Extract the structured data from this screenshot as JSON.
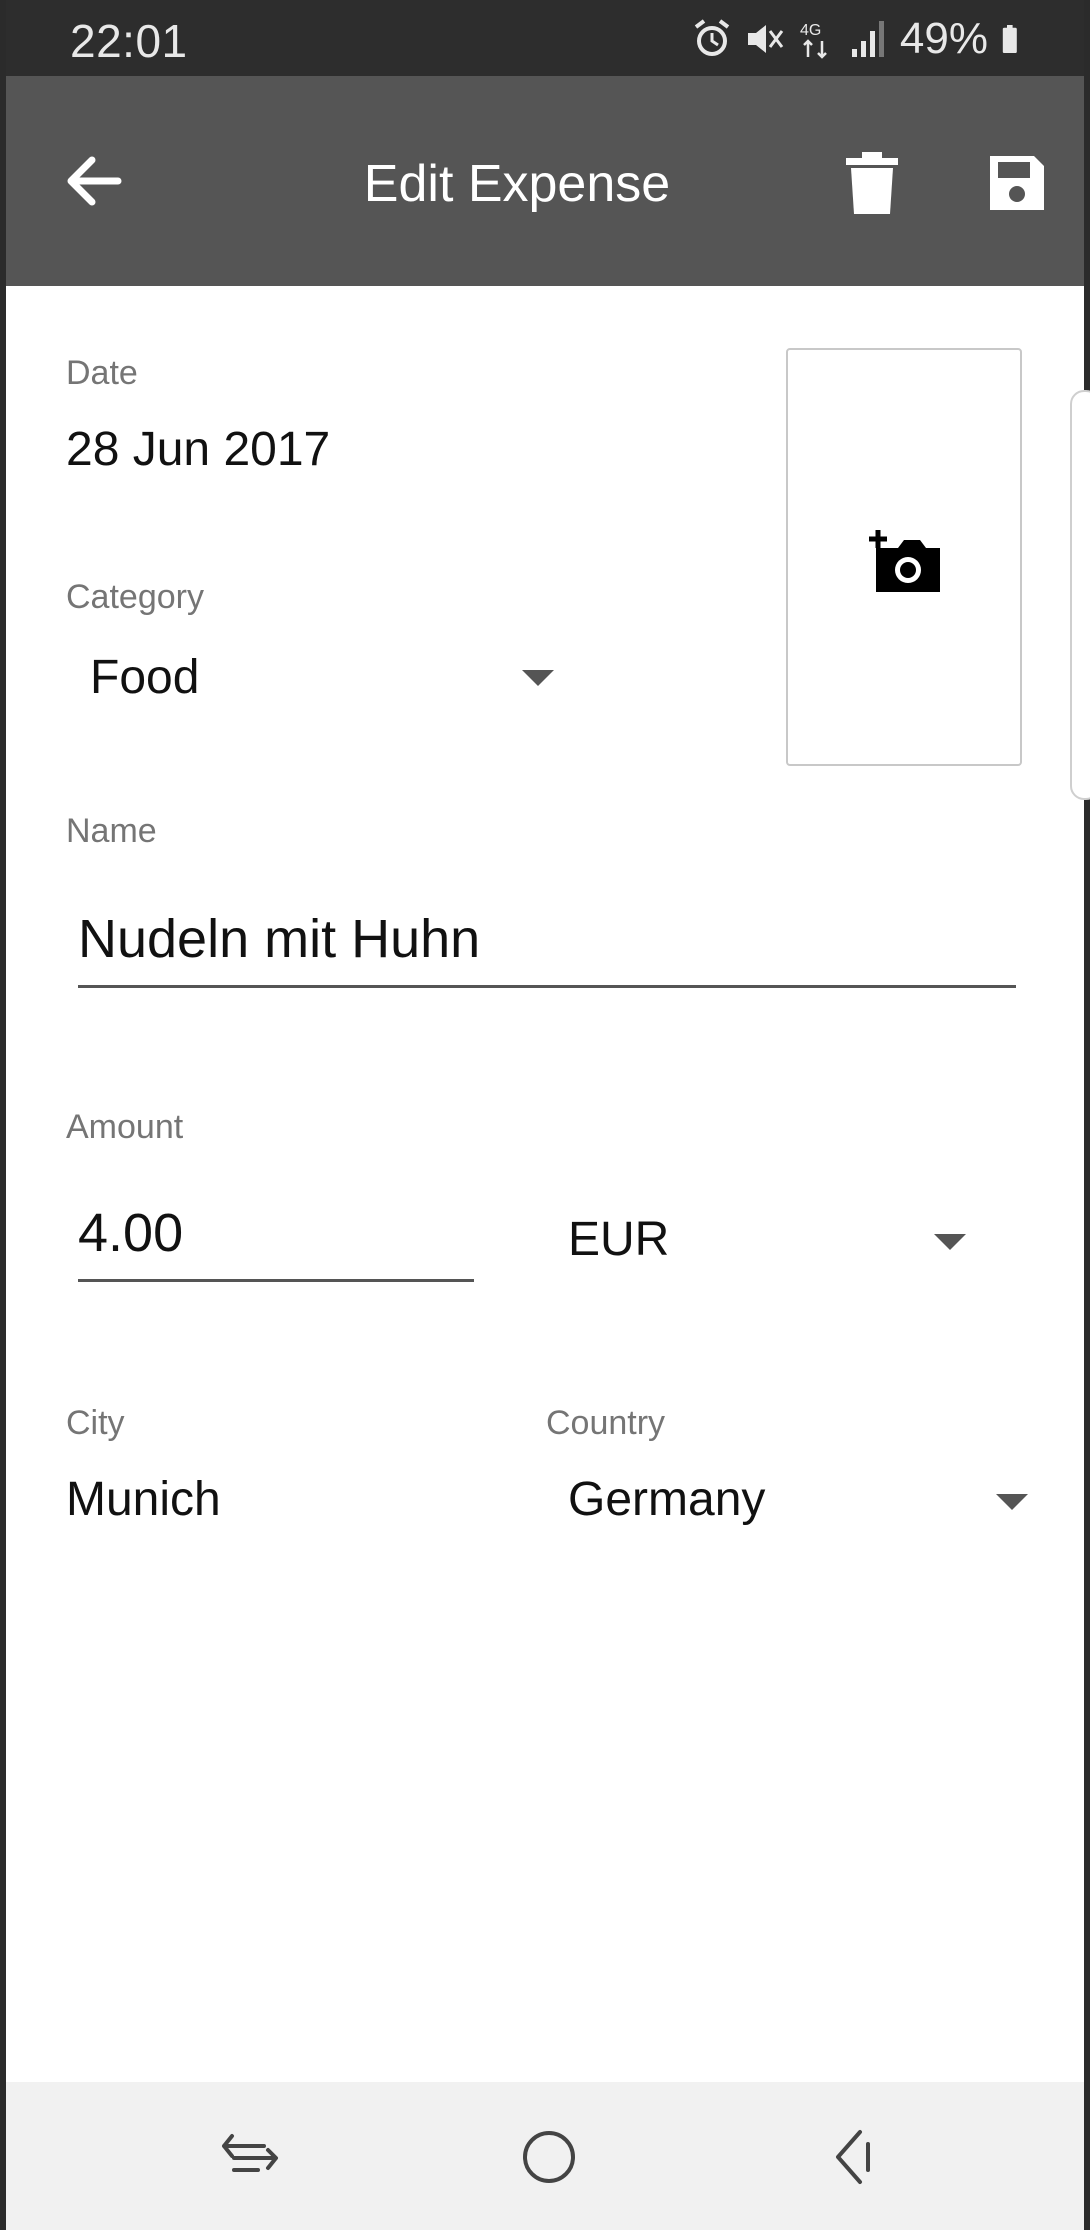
{
  "status_bar": {
    "time": "22:01",
    "battery_percent": "49%",
    "icons": [
      "alarm-icon",
      "mute-icon",
      "4g-icon",
      "signal-icon",
      "battery-icon"
    ]
  },
  "toolbar": {
    "title": "Edit Expense",
    "icons": [
      "back-arrow-icon",
      "delete-icon",
      "save-icon"
    ]
  },
  "form": {
    "date": {
      "label": "Date",
      "value": "28 Jun 2017"
    },
    "category": {
      "label": "Category",
      "value": "Food"
    },
    "name": {
      "label": "Name",
      "value": "Nudeln mit Huhn"
    },
    "amount": {
      "label": "Amount",
      "value": "4.00",
      "currency": "EUR"
    },
    "city": {
      "label": "City",
      "value": "Munich"
    },
    "country": {
      "label": "Country",
      "value": "Germany"
    },
    "photo_icon": "add-photo-icon"
  },
  "nav_bar": {
    "icons": [
      "recent-apps-icon",
      "home-icon",
      "back-icon"
    ]
  },
  "colors": {
    "status_bar": "#2d2d2d",
    "toolbar": "#555555",
    "label": "#757575",
    "nav_bar": "#f1f1f1"
  }
}
